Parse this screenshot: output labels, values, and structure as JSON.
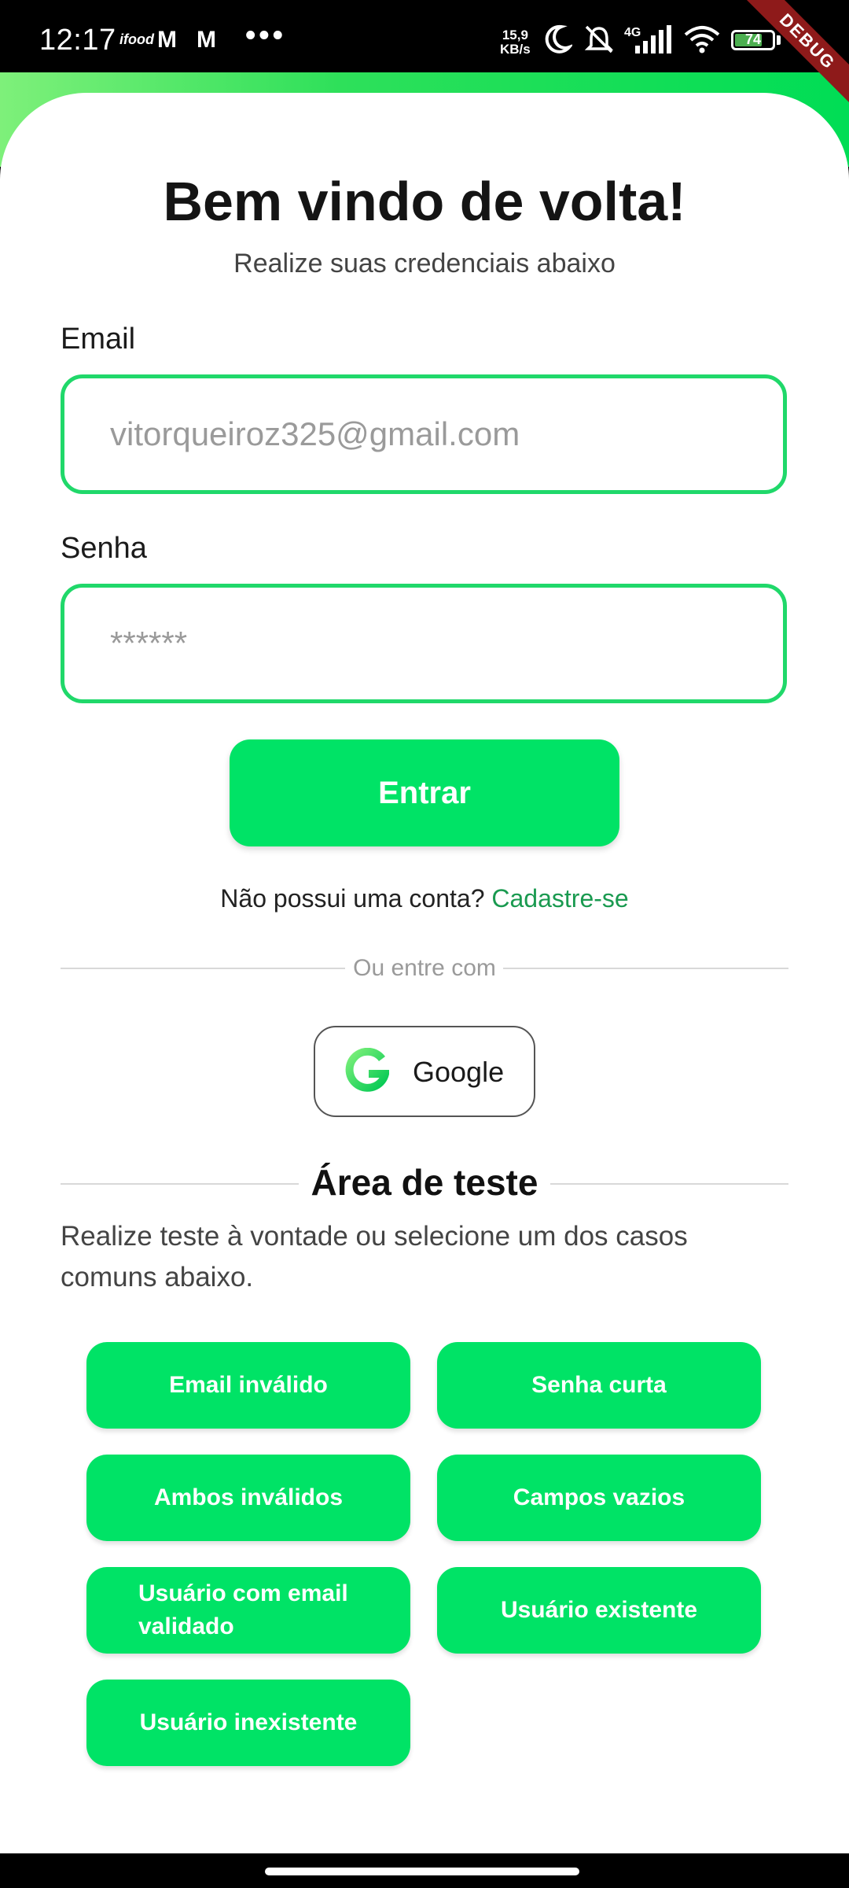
{
  "status_bar": {
    "time": "12:17",
    "ifood": "ifood",
    "mail_icons": [
      "M",
      "M"
    ],
    "more": "•••",
    "speed_value": "15,9",
    "speed_unit": "KB/s",
    "network": "4G",
    "battery": "74",
    "battery_level": 0.74,
    "debug_banner": "DEBUG"
  },
  "login": {
    "title": "Bem vindo de volta!",
    "subtitle": "Realize suas credenciais abaixo",
    "email_label": "Email",
    "email_placeholder": "vitorqueiroz325@gmail.com",
    "password_label": "Senha",
    "password_placeholder": "******",
    "submit_label": "Entrar",
    "no_account_text": "Não possui uma conta?",
    "signup_link": "Cadastre-se",
    "or_text": "Ou entre com",
    "google_label": "Google"
  },
  "test_area": {
    "title": "Área de teste",
    "description": "Realize teste à vontade ou selecione um dos casos comuns abaixo.",
    "buttons": [
      "Email inválido",
      "Senha curta",
      "Ambos inválidos",
      "Campos vazios",
      "Usuário com email validado",
      "Usuário existente",
      "Usuário inexistente"
    ]
  },
  "colors": {
    "accent": "#00e366",
    "field_border": "#20d86a",
    "link": "#1a9a50"
  }
}
